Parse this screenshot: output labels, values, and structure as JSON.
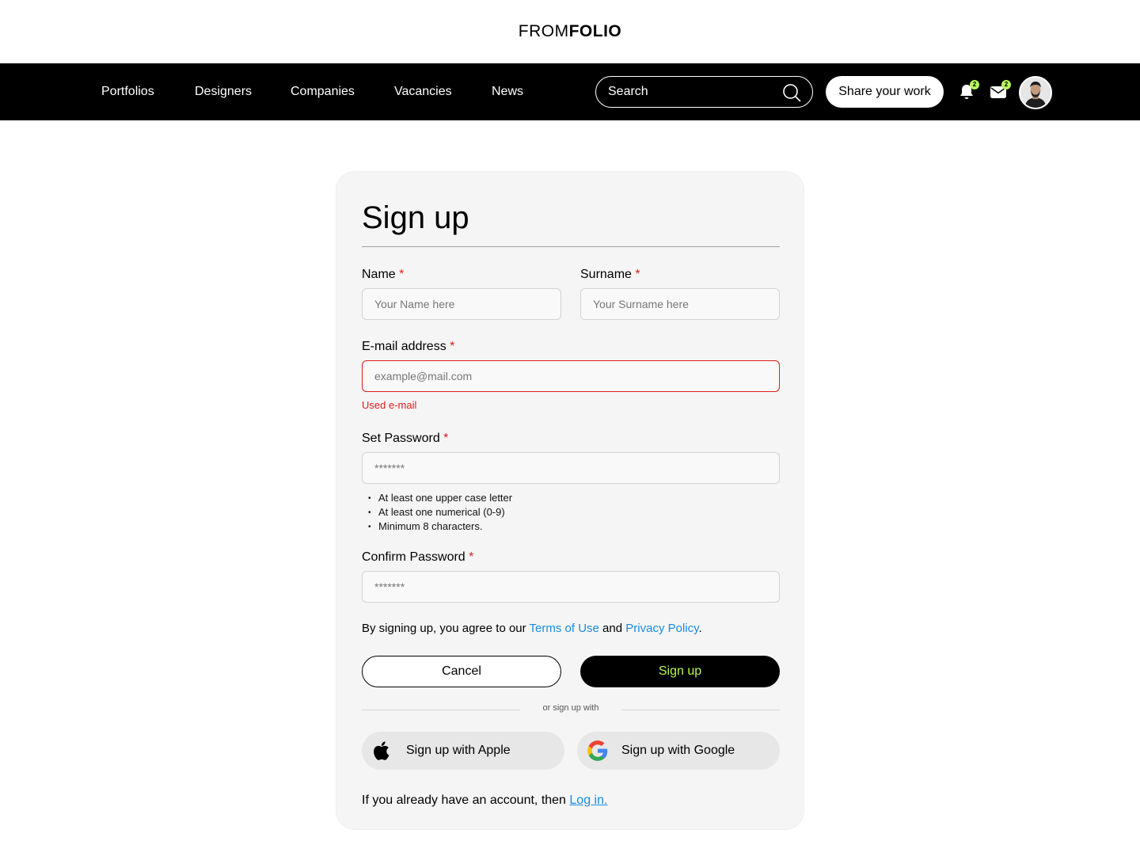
{
  "brand": {
    "light": "FROM",
    "bold": "FOLIO"
  },
  "nav": {
    "links": [
      "Portfolios",
      "Designers",
      "Companies",
      "Vacancies",
      "News"
    ],
    "search_placeholder": "Search",
    "share_label": "Share your work",
    "notifications_count": "2",
    "messages_count": "2"
  },
  "form": {
    "title": "Sign up",
    "name": {
      "label": "Name",
      "placeholder": "Your Name here"
    },
    "surname": {
      "label": "Surname",
      "placeholder": "Your Surname here"
    },
    "email": {
      "label": "E-mail address",
      "placeholder": "example@mail.com",
      "error": "Used e-mail"
    },
    "password": {
      "label": "Set Password",
      "placeholder": "*******"
    },
    "password_rules": [
      "At least one upper case letter",
      "At least one numerical (0-9)",
      "Minimum 8 characters."
    ],
    "confirm": {
      "label": "Confirm Password",
      "placeholder": "*******"
    },
    "required_mark": "*",
    "agree_prefix": "By signing up, you agree to our ",
    "terms": "Terms of Use",
    "and": " and ",
    "privacy": "Privacy Policy",
    "period": ".",
    "cancel_label": "Cancel",
    "signup_label": "Sign up",
    "or_text": "or sign up with",
    "apple_label": "Sign up with Apple",
    "google_label": "Sign up with Google",
    "login_prefix": "If you already have an account, then ",
    "login_link": "Log in."
  },
  "colors": {
    "accent": "#b8f55a",
    "link": "#1a8be0",
    "error": "#e01b1b",
    "nav_bg": "#000000",
    "card_bg": "#f5f5f5"
  },
  "icons": [
    "search-icon",
    "bell-icon",
    "mail-icon",
    "avatar",
    "apple-icon",
    "google-icon"
  ]
}
